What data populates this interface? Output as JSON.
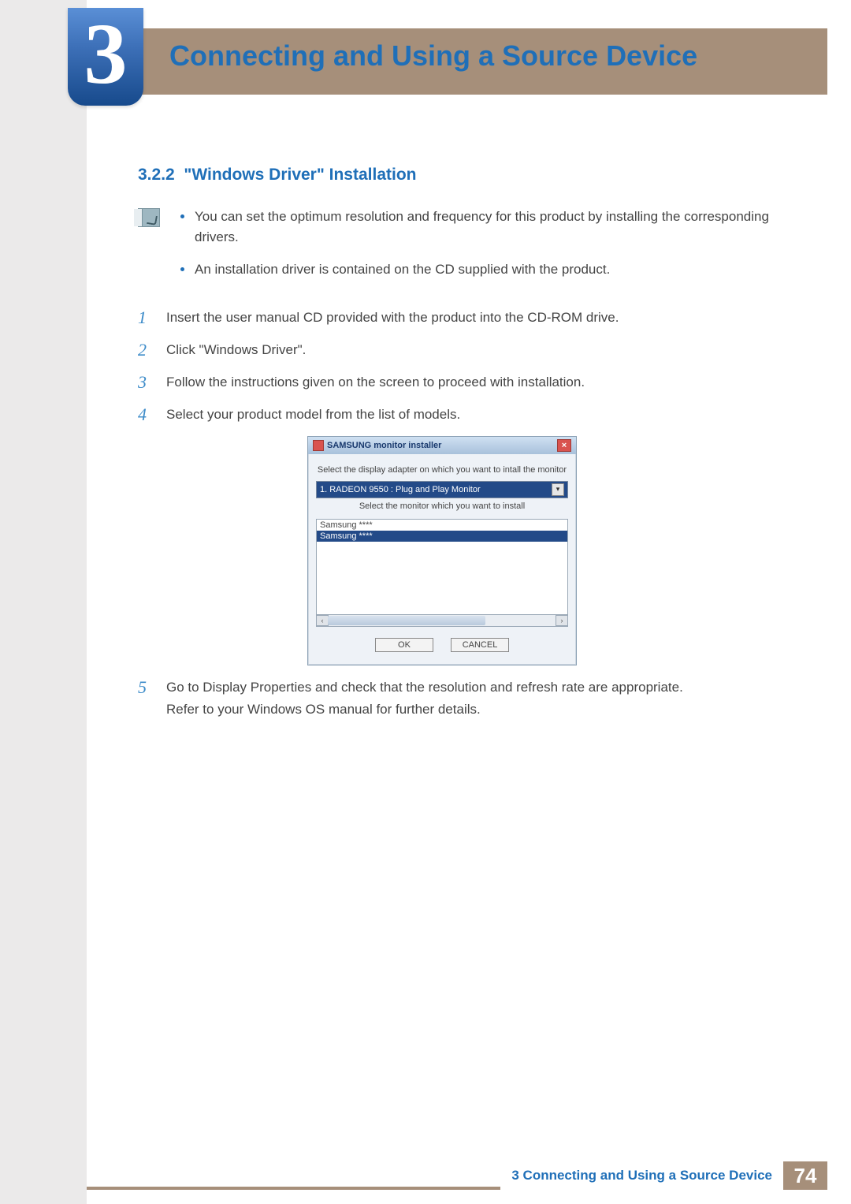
{
  "chapter": {
    "number": "3",
    "title": "Connecting and Using a Source Device"
  },
  "section": {
    "number": "3.2.2",
    "title": "\"Windows Driver\" Installation"
  },
  "notes": [
    "You can set the optimum resolution and frequency for this product by installing the corresponding drivers.",
    "An installation driver is contained on the CD supplied with the product."
  ],
  "steps": {
    "s1": "Insert the user manual CD provided with the product into the CD-ROM drive.",
    "s2": "Click \"Windows Driver\".",
    "s3": "Follow the instructions given on the screen to proceed with installation.",
    "s4": "Select your product model from the list of models.",
    "s5a": "Go to Display Properties and check that the resolution and refresh rate are appropriate.",
    "s5b": "Refer to your Windows OS manual for further details."
  },
  "dialog": {
    "title": "SAMSUNG monitor installer",
    "label_adapter": "Select the display adapter on which you want to intall the monitor",
    "adapter_selected": "1. RADEON 9550 : Plug and Play Monitor",
    "label_monitor": "Select the monitor which you want to install",
    "monitor_option_a": "Samsung ****",
    "monitor_option_b": "Samsung ****",
    "btn_ok": "OK",
    "btn_cancel": "CANCEL"
  },
  "footer": {
    "chapter_label": "3 Connecting and Using a Source Device",
    "page_number": "74"
  }
}
